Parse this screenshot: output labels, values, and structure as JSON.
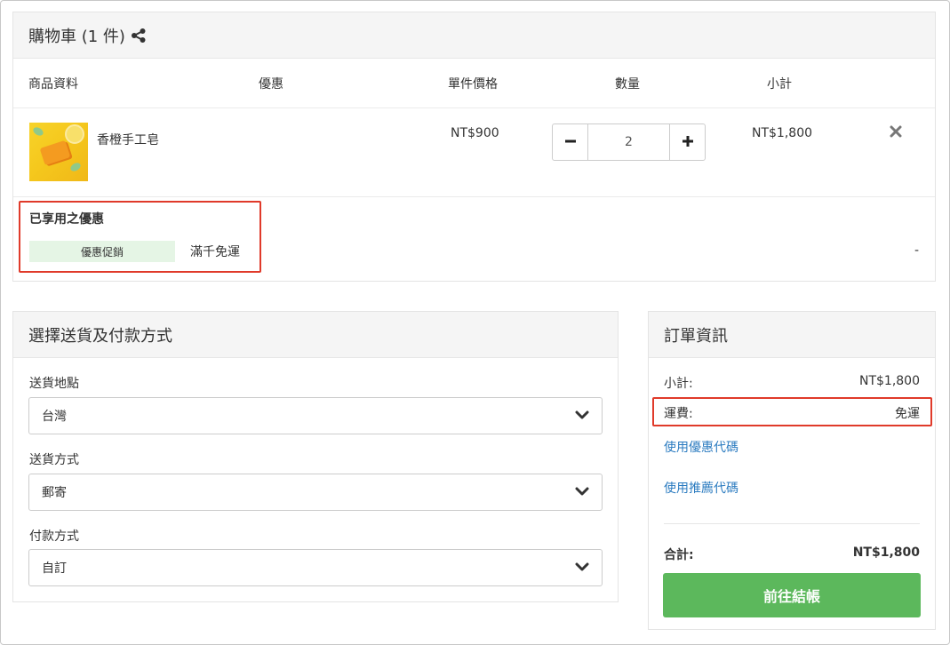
{
  "cart": {
    "title": "購物車 (1 件)",
    "columns": {
      "product": "商品資料",
      "discount": "優惠",
      "unit_price": "單件價格",
      "quantity": "數量",
      "subtotal": "小計"
    },
    "item": {
      "name": "香橙手工皂",
      "unit_price": "NT$900",
      "quantity": "2",
      "subtotal": "NT$1,800"
    },
    "applied_promo": {
      "title": "已享用之優惠",
      "tag": "優惠促銷",
      "text": "滿千免運",
      "amount": "-"
    }
  },
  "shipping": {
    "title": "選擇送貨及付款方式",
    "location_label": "送貨地點",
    "location_value": "台灣",
    "method_label": "送貨方式",
    "method_value": "郵寄",
    "payment_label": "付款方式",
    "payment_value": "自訂"
  },
  "order": {
    "title": "訂單資訊",
    "subtotal_label": "小計:",
    "subtotal_value": "NT$1,800",
    "shipping_label": "運費:",
    "shipping_value": "免運",
    "coupon_link": "使用優惠代碼",
    "referral_link": "使用推薦代碼",
    "total_label": "合計:",
    "total_value": "NT$1,800",
    "checkout_label": "前往結帳"
  },
  "colors": {
    "highlight": "#e03a2a",
    "checkout_button": "#5cb85c",
    "promo_tag_bg": "#e5f5e5",
    "link": "#2b7bc0"
  },
  "icons": [
    "share-icon",
    "minus-icon",
    "plus-icon",
    "close-icon",
    "chevron-down-icon"
  ]
}
